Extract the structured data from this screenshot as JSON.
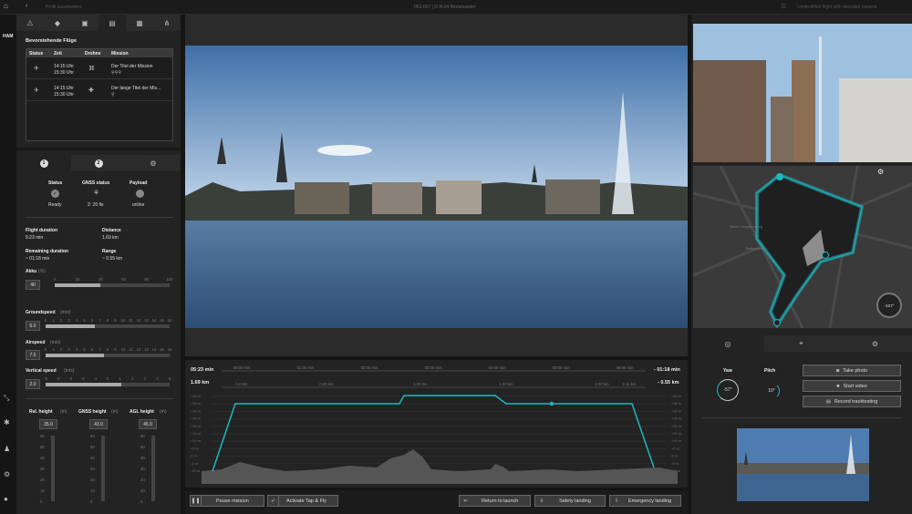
{
  "topbar": {
    "breadcrumb": "Profil ausarbeiten",
    "title": "052-007 | D-B-04 Binnenalster",
    "right_text": "Unidentified flight with decoded camera"
  },
  "sidebar": {
    "location": "HAM"
  },
  "flights": {
    "title": "Bevorstehende Flüge",
    "headers": [
      "Status",
      "Zeit",
      "Drohne",
      "Mission"
    ],
    "rows": [
      {
        "time_start": "14:15 Uhr",
        "time_end": "15:30 Uhr",
        "mission": "Der Titel der Mission"
      },
      {
        "time_start": "14:15 Uhr",
        "time_end": "15:30 Uhr",
        "mission": "Der lange Titel der Mis..."
      }
    ]
  },
  "tabs2": {
    "t1": "1",
    "t2": "2"
  },
  "status": {
    "status_label": "Status",
    "status_value": "Ready",
    "gnss_label": "GNSS status",
    "gnss_value": "2: 20 fix",
    "payload_label": "Payload",
    "payload_value": "online"
  },
  "flight": {
    "duration_label": "Flight duration",
    "duration_value": "5:23 min",
    "distance_label": "Distance",
    "distance_value": "1.69 km",
    "remaining_label": "Remaining duration",
    "remaining_value": "~ 01:18 min",
    "range_label": "Range",
    "range_value": "~ 0.55 km"
  },
  "akku": {
    "label": "Akku",
    "unit": "(%)",
    "value": "40",
    "level": 0.4,
    "ticks": [
      "0",
      "20",
      "40",
      "60",
      "80",
      "100"
    ]
  },
  "groundspeed": {
    "label": "Groundspeed",
    "unit": "(m/s)",
    "value": "6.0",
    "level": 0.4,
    "ticks": [
      "0",
      "1",
      "2",
      "3",
      "4",
      "5",
      "6",
      "7",
      "8",
      "9",
      "10",
      "11",
      "12",
      "13",
      "14",
      "15",
      "16"
    ]
  },
  "airspeed": {
    "label": "Airspeed",
    "unit": "(m/s)",
    "value": "7.5",
    "level": 0.47,
    "ticks": [
      "0",
      "1",
      "2",
      "3",
      "4",
      "5",
      "6",
      "7",
      "8",
      "9",
      "10",
      "11",
      "12",
      "13",
      "14",
      "15",
      "16"
    ]
  },
  "vspeed": {
    "label": "Vertical speed",
    "unit": "(m/s)",
    "value": "2.0",
    "level": 0.61,
    "ticks": [
      "-5",
      "-4",
      "-3",
      "-2",
      "-1",
      "0",
      "1",
      "2",
      "3",
      "4",
      "5"
    ]
  },
  "heights": {
    "rel_label": "Rel. height",
    "rel_unit": "(m)",
    "rel_value": "35.0",
    "gnss_label": "GNSS height",
    "gnss_unit": "(m)",
    "gnss_value": "43.0",
    "agl_label": "AGL height",
    "agl_unit": "(m)",
    "agl_value": "45.0",
    "ticks": [
      "60",
      "50",
      "40",
      "30",
      "20",
      "10",
      "0"
    ]
  },
  "timeline": {
    "left_time": "05:23 min",
    "left_dist": "1.69 km",
    "right_time": "- 01:18 min",
    "right_dist": "- 0.55 km",
    "time_ticks": [
      "00:00 min",
      "01:00 min",
      "02:00 min",
      "03:00 min",
      "04:00 min",
      "05:00 min",
      "06:00 min"
    ],
    "dist_ticks": [
      "0.0 km",
      "0.50 km",
      "1.00 km",
      "1.50 km",
      "2.00 km",
      "2.11 km"
    ],
    "alt_ticks": [
      "+40 m",
      "+35 m",
      "+30 m",
      "+25 m",
      "+20 m",
      "+15 m",
      "+10 m",
      "+5 m",
      "0 m",
      "-5 m",
      "-10 m"
    ]
  },
  "bottom": {
    "pause": "Pause mission",
    "tapfly": "Activate Tap & Fly",
    "rtl": "Return to launch",
    "safety": "Safety landing",
    "emergency": "Emergency landing"
  },
  "camera": {
    "yaw_label": "Yaw",
    "yaw_value": "-57°",
    "pitch_label": "Pitch",
    "pitch_value": "10°",
    "take_photo": "Take photo",
    "start_video": "Start video",
    "record": "Record tracktesting"
  },
  "compass": {
    "heading": "-127°"
  },
  "map": {
    "street1": "Neuer Jungfernstieg",
    "street2": "Ballindamm"
  },
  "colors": {
    "accent": "#1fb7c2",
    "panel": "#232323"
  }
}
